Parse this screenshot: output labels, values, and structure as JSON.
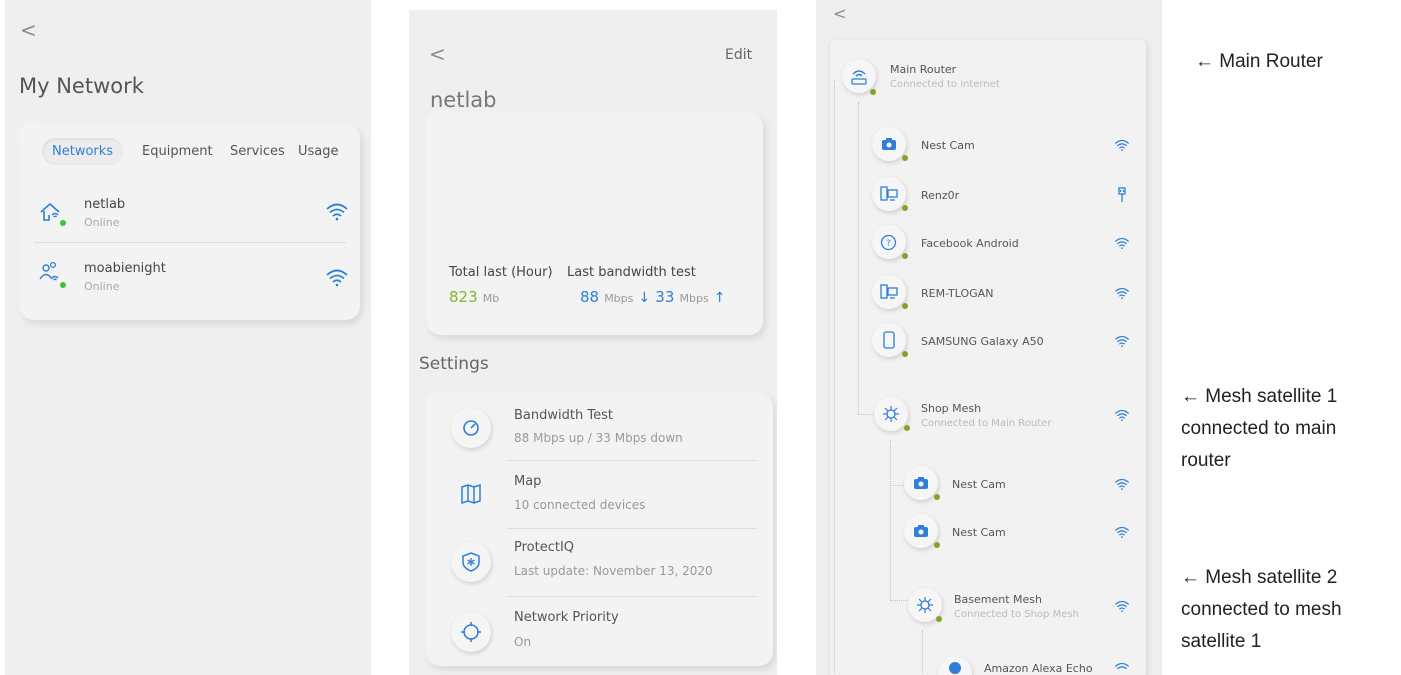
{
  "panel1": {
    "back": "<",
    "title": "My Network",
    "tabs": [
      "Networks",
      "Equipment",
      "Services",
      "Usage"
    ],
    "networks": [
      {
        "name": "netlab",
        "status": "Online",
        "icon": "home-wifi-icon"
      },
      {
        "name": "moabienight",
        "status": "Online",
        "icon": "guest-users-icon"
      }
    ]
  },
  "panel2": {
    "back": "<",
    "edit": "Edit",
    "title": "netlab",
    "usage_label": "Total last (Hour)",
    "usage_value": "823",
    "usage_unit": "Mb",
    "bw_label": "Last bandwidth test",
    "bw_down": "88",
    "bw_down_unit": "Mbps",
    "bw_down_arrow": "↓",
    "bw_up": "33",
    "bw_up_unit": "Mbps",
    "bw_up_arrow": "↑",
    "settings_title": "Settings",
    "settings": [
      {
        "name": "Bandwidth Test",
        "sub": "88 Mbps up / 33 Mbps down",
        "icon": "speedometer-icon"
      },
      {
        "name": "Map",
        "sub": "10 connected devices",
        "icon": "map-icon"
      },
      {
        "name": "ProtectIQ",
        "sub": "Last update: November 13, 2020",
        "icon": "shield-icon"
      },
      {
        "name": "Network Priority",
        "sub": "On",
        "icon": "priority-icon"
      }
    ]
  },
  "panel3": {
    "back": "<",
    "main_router": {
      "name": "Main Router",
      "sub": "Connected to internet"
    },
    "devices_main": [
      {
        "name": "Nest Cam",
        "conn": "wifi"
      },
      {
        "name": "Renz0r",
        "conn": "ethernet"
      },
      {
        "name": "Facebook Android",
        "conn": "wifi"
      },
      {
        "name": "REM-TLOGAN",
        "conn": "wifi"
      },
      {
        "name": "SAMSUNG Galaxy A50",
        "conn": "wifi"
      }
    ],
    "shop_mesh": {
      "name": "Shop Mesh",
      "sub": "Connected to Main Router"
    },
    "devices_shop": [
      {
        "name": "Nest Cam"
      },
      {
        "name": "Nest Cam"
      }
    ],
    "basement_mesh": {
      "name": "Basement Mesh",
      "sub": "Connected to Shop Mesh"
    },
    "devices_basement": [
      {
        "name": "Amazon Alexa Echo"
      }
    ]
  },
  "annotations": {
    "main_router": "← Main Router",
    "mesh1": [
      "← Mesh satellite 1",
      "connected to main",
      "router"
    ],
    "mesh2": [
      "← Mesh satellite 2",
      "connected to mesh",
      "satellite 1"
    ]
  },
  "colors": {
    "accent_blue": "#2f7fd8",
    "online_green": "#3ec43e",
    "usage_green": "#7cb82f",
    "status_olive": "#8aa02a"
  }
}
